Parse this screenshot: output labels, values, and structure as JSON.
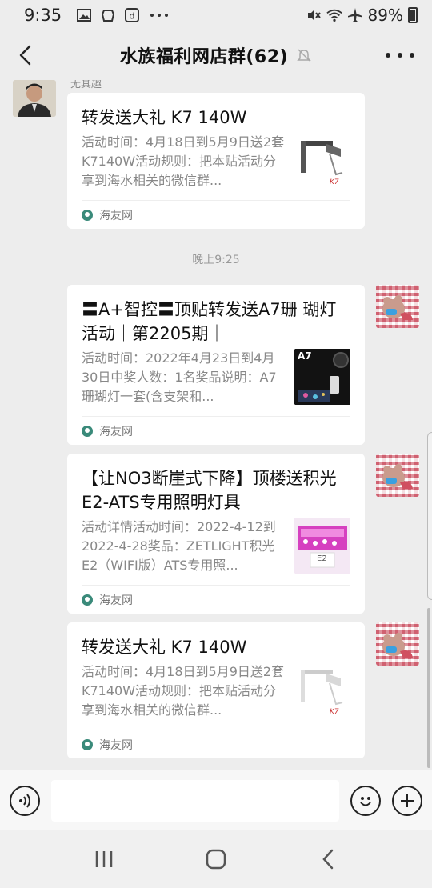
{
  "status_bar": {
    "time": "9:35",
    "battery": "89%",
    "left_icons": [
      "image-icon",
      "box-icon",
      "d-icon",
      "more-dots"
    ],
    "right_icons": [
      "mute-icon",
      "wifi-icon",
      "airplane-icon",
      "battery-icon"
    ]
  },
  "header": {
    "title": "水族福利网店群(62)"
  },
  "chat": {
    "sender_name": "无其趣",
    "timestamp": "晚上9:25",
    "messages": [
      {
        "title": "转发送大礼 K7 140W",
        "desc": "活动时间：4月18日到5月9日送2套K7140W活动规则：把本贴活动分享到海水相关的微信群...",
        "source": "海友网",
        "thumb_icon": "light-fixture-icon"
      },
      {
        "title": "〓A+智控〓顶贴转发送A7珊 瑚灯活动｜第2205期｜",
        "desc": "活动时间：2022年4月23日到4月30日中奖人数：1名奖品说明：A7珊瑚灯一套(含支架和...",
        "source": "海友网",
        "thumb_label": "A7",
        "thumb_icon": "a7-product-icon"
      },
      {
        "title": "【让NO3断崖式下降】顶楼送积光E2-ATS专用照明灯具",
        "desc": "活动详情活动时间：2022-4-12到2022-4-28奖品：ZETLIGHT积光E2（WIFI版）ATS专用照...",
        "source": "海友网",
        "thumb_label": "E2",
        "thumb_icon": "e2-product-icon"
      },
      {
        "title": "转发送大礼 K7 140W",
        "desc": "活动时间：4月18日到5月9日送2套K7140W活动规则：把本贴活动分享到海水相关的微信群...",
        "source": "海友网",
        "thumb_icon": "light-fixture-icon"
      }
    ]
  },
  "input": {
    "value": "",
    "placeholder": ""
  },
  "colors": {
    "background": "#ededed",
    "card": "#ffffff",
    "accent_source": "#3a8a7a"
  }
}
